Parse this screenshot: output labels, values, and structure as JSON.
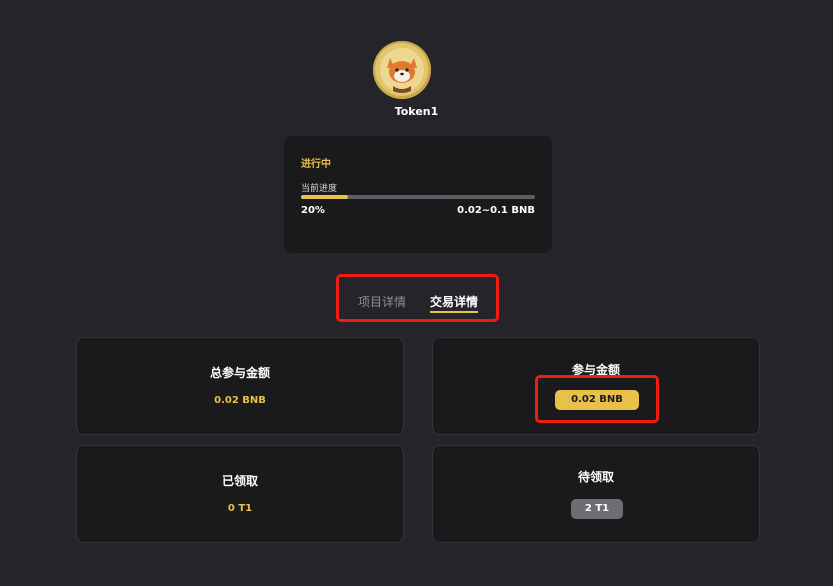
{
  "token": {
    "name": "Token1",
    "icon": "shiba-dog-coin-icon"
  },
  "progress_card": {
    "status": "进行中",
    "caption": "当前进度",
    "percent_text": "20%",
    "percent_value": 0.2,
    "range_text": "0.02~0.1 BNB"
  },
  "tabs": [
    {
      "label": "项目详情",
      "active": false
    },
    {
      "label": "交易详情",
      "active": true
    }
  ],
  "stats": {
    "total_participation": {
      "title": "总参与金额",
      "value": "0.02 BNB"
    },
    "participation": {
      "title": "参与金额",
      "value": "0.02 BNB"
    },
    "claimed": {
      "title": "已领取",
      "value": "0 T1"
    },
    "pending_claim": {
      "title": "待领取",
      "value": "2 T1"
    }
  },
  "colors": {
    "background": "#252529",
    "card": "#1a1a1c",
    "accent": "#e8c04a",
    "highlight_box": "#f01c14",
    "muted_pill": "#6e6e72"
  }
}
